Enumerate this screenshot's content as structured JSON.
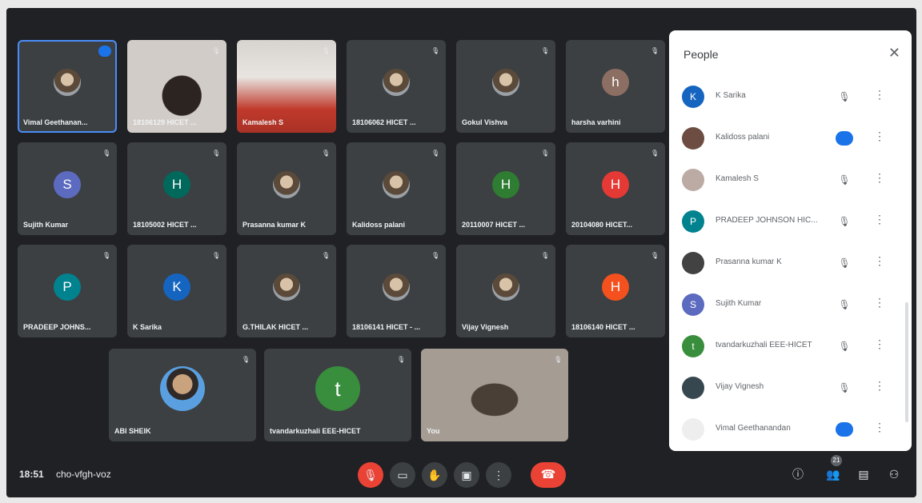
{
  "meeting": {
    "time": "18:51",
    "code": "cho-vfgh-voz"
  },
  "tiles": [
    {
      "name": "Vimal Geethanan...",
      "kind": "photo",
      "active": true
    },
    {
      "name": "18106129 HICET ...",
      "kind": "video"
    },
    {
      "name": "Kamalesh S",
      "kind": "video"
    },
    {
      "name": "18106062 HICET ...",
      "kind": "photo"
    },
    {
      "name": "Gokul Vishva",
      "kind": "photo"
    },
    {
      "name": "harsha varhini",
      "kind": "avatar",
      "initial": "h",
      "color": "#8d6e63"
    },
    {
      "name": "Sujith Kumar",
      "kind": "avatar",
      "initial": "S",
      "color": "#5c6bc0"
    },
    {
      "name": "18105002 HICET ...",
      "kind": "avatar",
      "initial": "H",
      "color": "#00695c"
    },
    {
      "name": "Prasanna kumar K",
      "kind": "photo"
    },
    {
      "name": "Kalidoss palani",
      "kind": "photo"
    },
    {
      "name": "20110007 HICET ...",
      "kind": "avatar",
      "initial": "H",
      "color": "#2e7d32"
    },
    {
      "name": "20104080 HICET...",
      "kind": "avatar",
      "initial": "H",
      "color": "#e53935"
    },
    {
      "name": "PRADEEP JOHNS...",
      "kind": "avatar",
      "initial": "P",
      "color": "#00838f"
    },
    {
      "name": "K Sarika",
      "kind": "avatar",
      "initial": "K",
      "color": "#1565c0"
    },
    {
      "name": "G.THILAK HICET ...",
      "kind": "photo"
    },
    {
      "name": "18106141 HICET - ...",
      "kind": "photo"
    },
    {
      "name": "Vijay Vignesh",
      "kind": "photo"
    },
    {
      "name": "18106140 HICET ...",
      "kind": "avatar",
      "initial": "H",
      "color": "#f4511e"
    },
    {
      "name": "ABI SHEIK",
      "kind": "bigphoto"
    },
    {
      "name": "tvandarkuzhali EEE-HICET",
      "kind": "bigavatar",
      "initial": "t",
      "color": "#388e3c"
    },
    {
      "name": "You",
      "kind": "video"
    }
  ],
  "people": {
    "title": "People",
    "participant_count": "21",
    "members": [
      {
        "name": "K Sarika",
        "initial": "K",
        "color": "#1565c0",
        "state": "muted"
      },
      {
        "name": "Kalidoss palani",
        "initial": "",
        "color": "#6d4c41",
        "state": "speaking"
      },
      {
        "name": "Kamalesh S",
        "initial": "",
        "color": "#bcaaa4",
        "state": "muted"
      },
      {
        "name": "PRADEEP JOHNSON HIC...",
        "initial": "P",
        "color": "#00838f",
        "state": "muted"
      },
      {
        "name": "Prasanna kumar K",
        "initial": "",
        "color": "#424242",
        "state": "muted"
      },
      {
        "name": "Sujith Kumar",
        "initial": "S",
        "color": "#5c6bc0",
        "state": "muted"
      },
      {
        "name": "tvandarkuzhali EEE-HICET",
        "initial": "t",
        "color": "#388e3c",
        "state": "muted"
      },
      {
        "name": "Vijay Vignesh",
        "initial": "",
        "color": "#37474f",
        "state": "muted"
      },
      {
        "name": "Vimal Geethanandan",
        "initial": "",
        "color": "#eeeeee",
        "state": "speaking"
      }
    ]
  },
  "controls": {
    "mic_icon": "mic-off-icon",
    "camera_icon": "camera-off-icon",
    "hand_icon": "raise-hand-icon",
    "present_icon": "present-icon",
    "more_icon": "more-vert-icon",
    "end_icon": "end-call-icon"
  }
}
